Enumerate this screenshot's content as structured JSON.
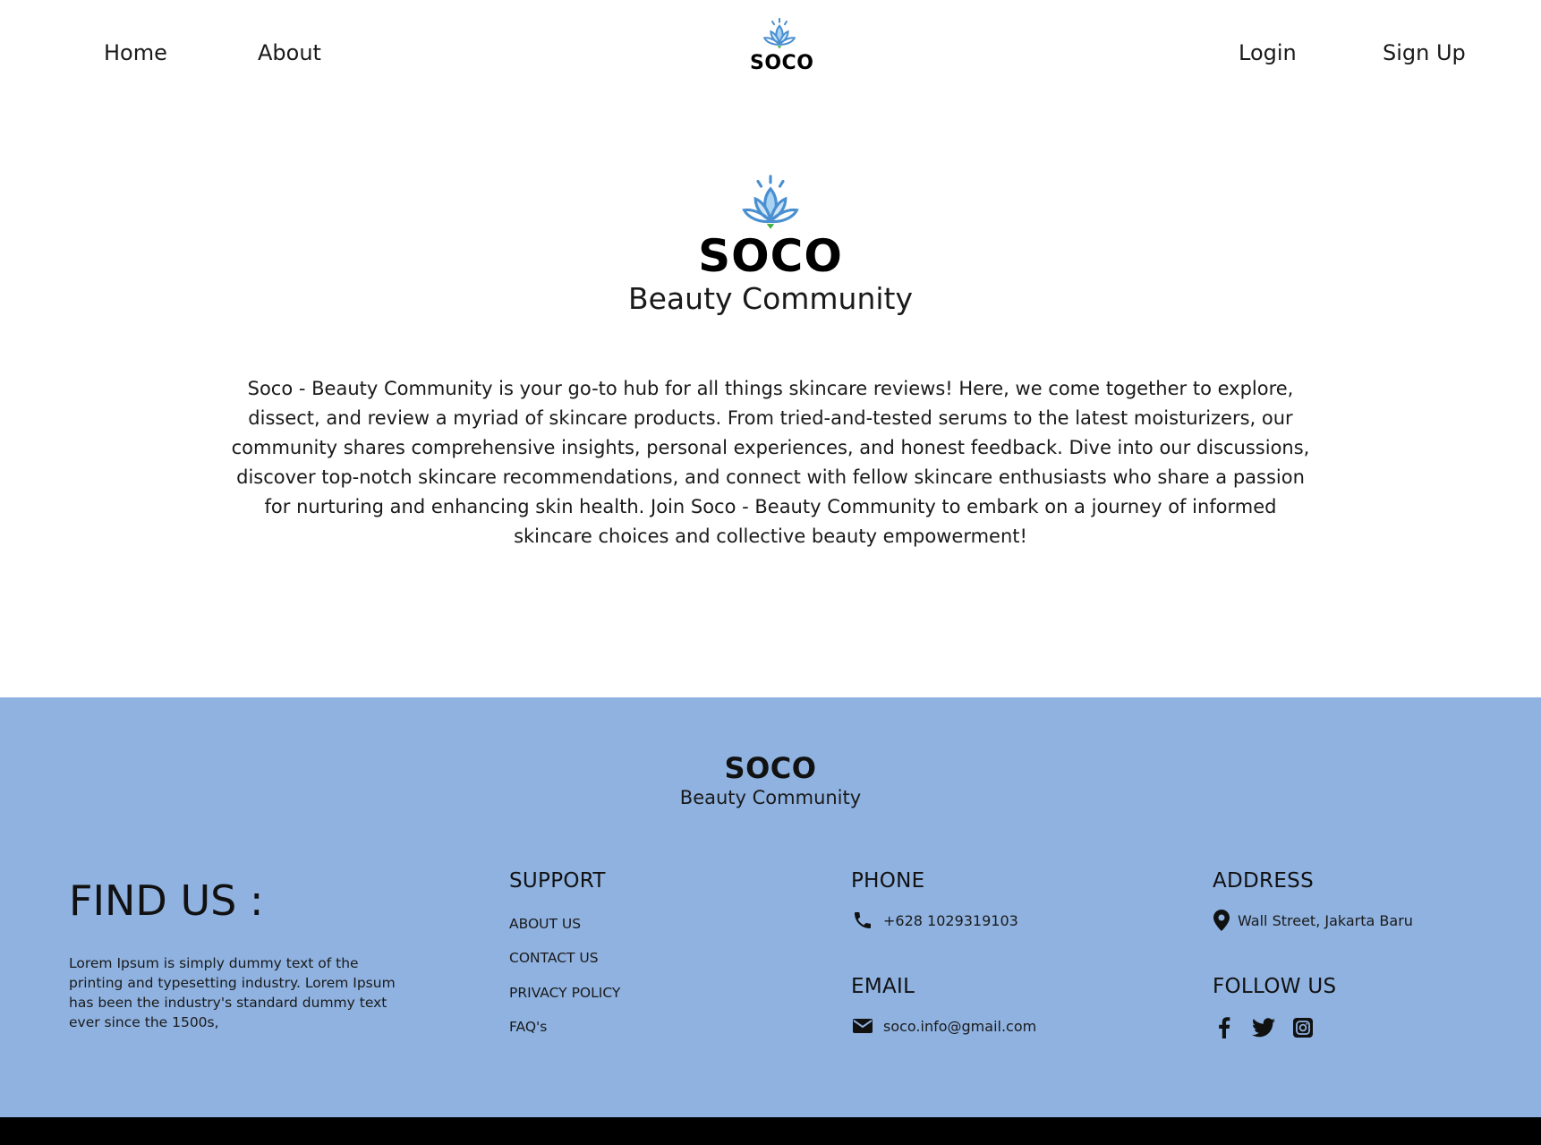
{
  "nav": {
    "home": "Home",
    "about": "About",
    "logo_text": "SOCO",
    "login": "Login",
    "signup": "Sign Up"
  },
  "hero": {
    "title": "SOCO",
    "subtitle": "Beauty Community",
    "description": "Soco - Beauty Community is your go-to hub for all things skincare reviews! Here, we come together to explore, dissect, and review a myriad of skincare products. From tried-and-tested serums to the latest moisturizers, our community shares comprehensive insights, personal experiences, and honest feedback. Dive into our discussions, discover top-notch skincare recommendations, and connect with fellow skincare enthusiasts who share a passion for nurturing and enhancing skin health. Join Soco - Beauty Community to embark on a journey of informed skincare choices and collective beauty empowerment!"
  },
  "footer": {
    "brand_title": "SOCO",
    "brand_subtitle": "Beauty Community",
    "find_us": "FIND US :",
    "find_us_text": "Lorem Ipsum is simply dummy text of the printing and typesetting industry. Lorem Ipsum has been the industry's standard dummy text ever since the 1500s,",
    "support": {
      "heading": "SUPPORT",
      "links": [
        "ABOUT US",
        "CONTACT US",
        "PRIVACY POLICY",
        "FAQ's"
      ]
    },
    "phone": {
      "heading": "PHONE",
      "value": "+628 1029319103",
      "icon": "phone-icon"
    },
    "email": {
      "heading": "EMAIL",
      "value": "soco.info@gmail.com",
      "icon": "envelope-icon"
    },
    "address": {
      "heading": "ADDRESS",
      "value": "Wall Street, Jakarta Baru",
      "icon": "map-pin-icon"
    },
    "follow": {
      "heading": "FOLLOW US",
      "icons": [
        "facebook-icon",
        "twitter-icon",
        "instagram-icon"
      ]
    }
  },
  "colors": {
    "footer_bg": "#8fb2e0",
    "lotus_blue": "#4a8fd0",
    "lotus_light": "#a9d3f2",
    "lotus_green": "#3fae3a",
    "bottom_bar": "#000000"
  }
}
